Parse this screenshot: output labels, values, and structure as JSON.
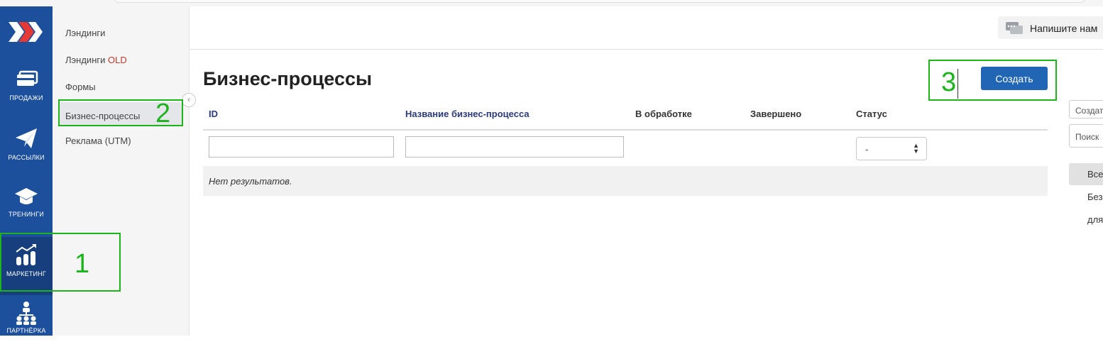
{
  "sidebar": {
    "items": [
      {
        "label": "ПРОДАЖИ",
        "icon": "sales-icon"
      },
      {
        "label": "РАССЫЛКИ",
        "icon": "paper-plane-icon"
      },
      {
        "label": "ТРЕНИНГИ",
        "icon": "graduation-cap-icon"
      },
      {
        "label": "МАРКЕТИНГ",
        "icon": "chart-icon",
        "active": true
      },
      {
        "label": "ПАРТНЁРКА",
        "icon": "partners-icon"
      }
    ]
  },
  "submenu": {
    "items": [
      {
        "label": "Лэндинги"
      },
      {
        "label": "Лэндинги",
        "suffix": "OLD"
      },
      {
        "label": "Формы"
      },
      {
        "label": "Бизнес-процессы",
        "active": true
      },
      {
        "label": "Реклама (UTM)"
      }
    ]
  },
  "header": {
    "chat_label": "Напишите нам"
  },
  "page": {
    "title": "Бизнес-процессы",
    "create_label": "Создать",
    "columns": [
      "ID",
      "Название бизнес-процесса",
      "В обработке",
      "Завершено",
      "Статус"
    ],
    "status_filter_value": "-",
    "empty_text": "Нет результатов."
  },
  "right_panel": {
    "inputs": [
      "Создат",
      "Поиск"
    ],
    "button_label": "Все",
    "texts": [
      "Без",
      "для"
    ]
  },
  "annotations": [
    "1",
    "2",
    "3"
  ],
  "colors": {
    "rail": "#1c4f9c",
    "accent": "#2166b4",
    "annotation": "#1db31d",
    "old_tag": "#c0392b"
  }
}
